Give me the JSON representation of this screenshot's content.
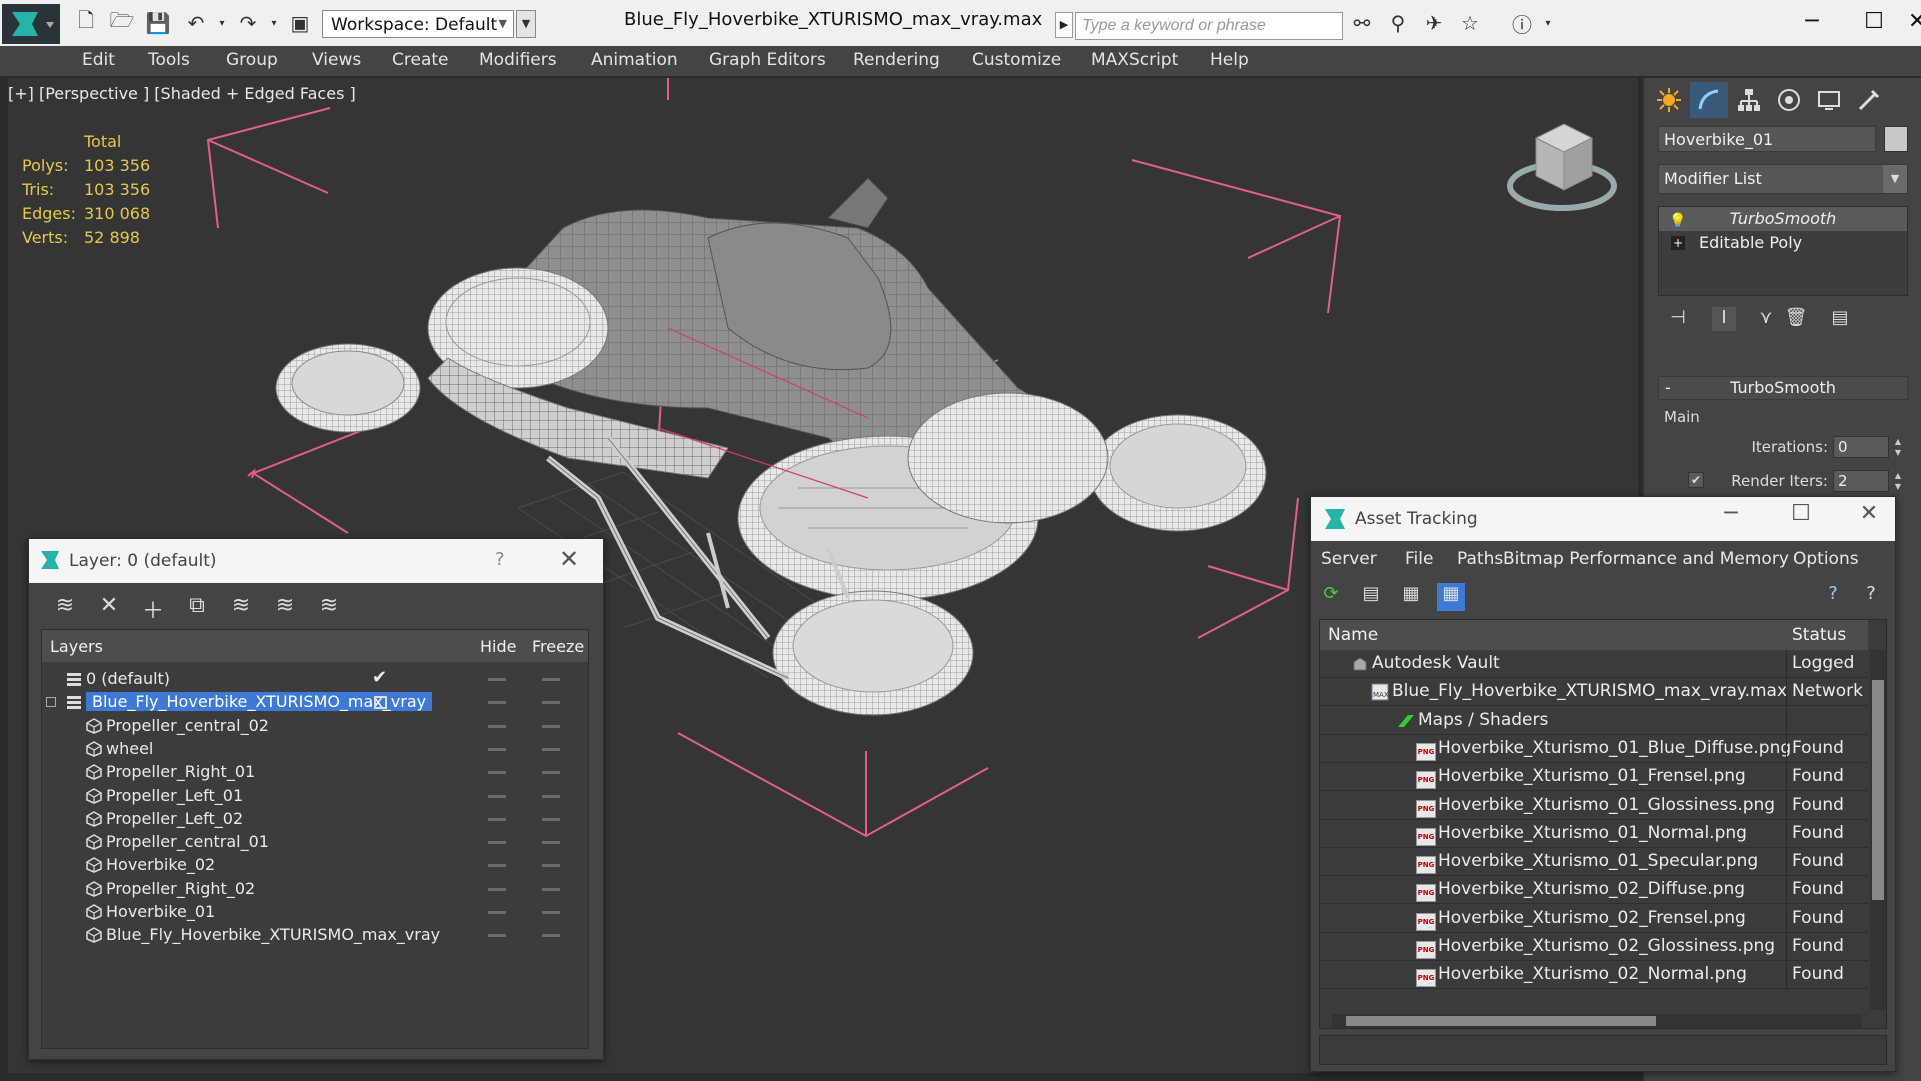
{
  "titlebar": {
    "workspace": "Workspace: Default",
    "document_title": "Blue_Fly_Hoverbike_XTURISMO_max_vray.max",
    "keyword_placeholder": "Type a keyword or phrase"
  },
  "menu": [
    "Edit",
    "Tools",
    "Group",
    "Views",
    "Create",
    "Modifiers",
    "Animation",
    "Graph Editors",
    "Rendering",
    "Customize",
    "MAXScript",
    "Help"
  ],
  "viewport": {
    "label": "[+] [Perspective ] [Shaded + Edged Faces ]",
    "stats": {
      "header": "Total",
      "rows": [
        {
          "label": "Polys:",
          "value": "103 356"
        },
        {
          "label": "Tris:",
          "value": "103 356"
        },
        {
          "label": "Edges:",
          "value": "310 068"
        },
        {
          "label": "Verts:",
          "value": "52 898"
        }
      ]
    }
  },
  "command_panel": {
    "object_name": "Hoverbike_01",
    "modifier_list": "Modifier List",
    "stack": [
      "TurboSmooth",
      "Editable Poly"
    ],
    "rollout_title": "TurboSmooth",
    "group_main": "Main",
    "iterations_label": "Iterations:",
    "iterations_value": "0",
    "render_iters_label": "Render Iters:",
    "render_iters_value": "2"
  },
  "layer_dialog": {
    "title": "Layer: 0 (default)",
    "help": "?",
    "columns": {
      "layers": "Layers",
      "hide": "Hide",
      "freeze": "Freeze"
    },
    "rows": [
      {
        "name": "0 (default)",
        "level": 0,
        "kind": "layer",
        "current": true
      },
      {
        "name": "Blue_Fly_Hoverbike_XTURISMO_max_vray",
        "level": 0,
        "kind": "layer",
        "selected": true,
        "expanded": true
      },
      {
        "name": "Propeller_central_02",
        "level": 1,
        "kind": "object"
      },
      {
        "name": "wheel",
        "level": 1,
        "kind": "object"
      },
      {
        "name": "Propeller_Right_01",
        "level": 1,
        "kind": "object"
      },
      {
        "name": "Propeller_Left_01",
        "level": 1,
        "kind": "object"
      },
      {
        "name": "Propeller_Left_02",
        "level": 1,
        "kind": "object"
      },
      {
        "name": "Propeller_central_01",
        "level": 1,
        "kind": "object"
      },
      {
        "name": "Hoverbike_02",
        "level": 1,
        "kind": "object"
      },
      {
        "name": "Propeller_Right_02",
        "level": 1,
        "kind": "object"
      },
      {
        "name": "Hoverbike_01",
        "level": 1,
        "kind": "object"
      },
      {
        "name": "Blue_Fly_Hoverbike_XTURISMO_max_vray",
        "level": 1,
        "kind": "object"
      }
    ]
  },
  "asset_tracking": {
    "title": "Asset Tracking",
    "menu": [
      "Server",
      "File",
      "Paths",
      "Bitmap Performance and Memory",
      "Options"
    ],
    "columns": {
      "name": "Name",
      "status": "Status"
    },
    "rows": [
      {
        "name": "Autodesk Vault",
        "status": "Logged",
        "level": 0,
        "icon": "vault-icon"
      },
      {
        "name": "Blue_Fly_Hoverbike_XTURISMO_max_vray.max",
        "status": "Network",
        "level": 1,
        "icon": "max-file-icon"
      },
      {
        "name": "Maps / Shaders",
        "status": "",
        "level": 2,
        "icon": "maps-icon"
      },
      {
        "name": "Hoverbike_Xturismo_01_Blue_Diffuse.png",
        "status": "Found",
        "level": 3,
        "icon": "png-icon"
      },
      {
        "name": "Hoverbike_Xturismo_01_Frensel.png",
        "status": "Found",
        "level": 3,
        "icon": "png-icon"
      },
      {
        "name": "Hoverbike_Xturismo_01_Glossiness.png",
        "status": "Found",
        "level": 3,
        "icon": "png-icon"
      },
      {
        "name": "Hoverbike_Xturismo_01_Normal.png",
        "status": "Found",
        "level": 3,
        "icon": "png-icon"
      },
      {
        "name": "Hoverbike_Xturismo_01_Specular.png",
        "status": "Found",
        "level": 3,
        "icon": "png-icon"
      },
      {
        "name": "Hoverbike_Xturismo_02_Diffuse.png",
        "status": "Found",
        "level": 3,
        "icon": "png-icon"
      },
      {
        "name": "Hoverbike_Xturismo_02_Frensel.png",
        "status": "Found",
        "level": 3,
        "icon": "png-icon"
      },
      {
        "name": "Hoverbike_Xturismo_02_Glossiness.png",
        "status": "Found",
        "level": 3,
        "icon": "png-icon"
      },
      {
        "name": "Hoverbike_Xturismo_02_Normal.png",
        "status": "Found",
        "level": 3,
        "icon": "png-icon"
      }
    ]
  },
  "colors": {
    "stats_text": "#e6c94a",
    "selection": "#3d7ad6",
    "bbox_lines": "#e0608a"
  }
}
